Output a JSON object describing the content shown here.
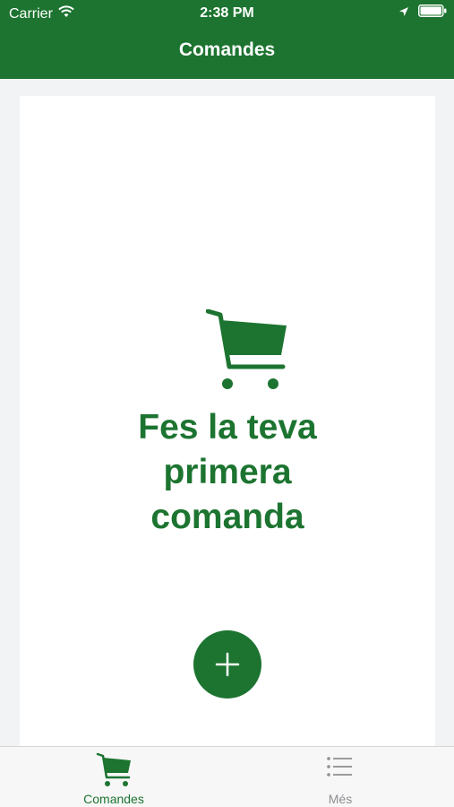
{
  "status_bar": {
    "carrier": "Carrier",
    "time": "2:38 PM"
  },
  "nav": {
    "title": "Comandes"
  },
  "empty_state": {
    "message_line1": "Fes la teva",
    "message_line2": "primera",
    "message_line3": "comanda",
    "icon": "shopping-cart-icon"
  },
  "tab_bar": {
    "tabs": [
      {
        "label": "Comandes",
        "icon": "shopping-cart-icon",
        "active": true
      },
      {
        "label": "Més",
        "icon": "list-icon",
        "active": false
      }
    ]
  },
  "colors": {
    "brand": "#1c7430",
    "background": "#f2f3f5",
    "card": "#ffffff",
    "tab_inactive": "#8e8e93"
  }
}
